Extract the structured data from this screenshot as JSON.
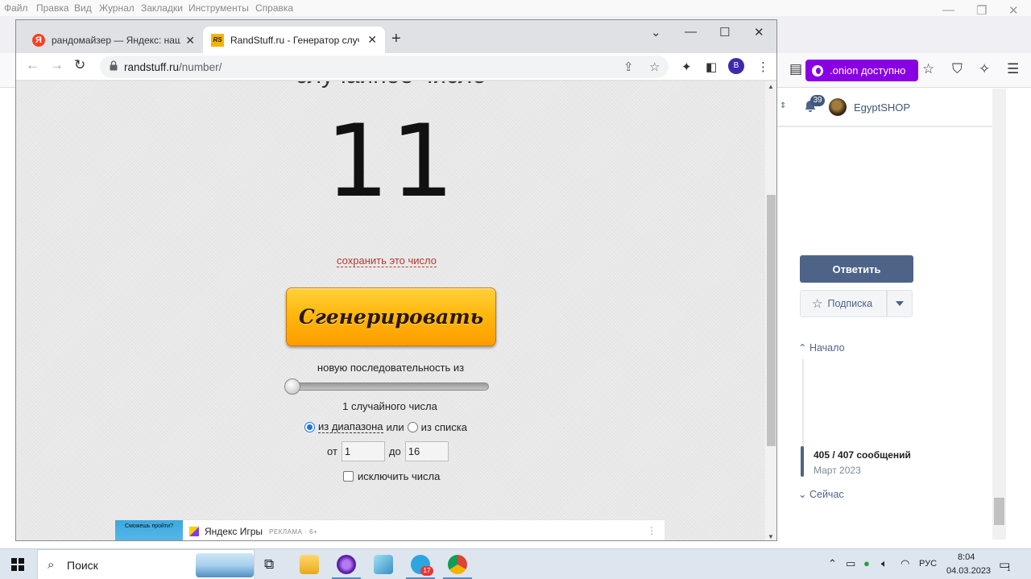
{
  "tor_browser": {
    "menu": [
      "Файл",
      "Правка",
      "Вид",
      "Журнал",
      "Закладки",
      "Инструменты",
      "Справка"
    ],
    "onion_button": ".onion доступно",
    "forum": {
      "notification_count": "39",
      "username": "EgyptSHOP",
      "reply_button": "Ответить",
      "subscribe_button": "Подписка",
      "nav_start": "Начало",
      "messages_count": "405 / 407 сообщений",
      "messages_date": "Март 2023",
      "nav_now": "Сейчас"
    }
  },
  "chrome": {
    "tabs": [
      {
        "title": "рандомайзер — Яндекс: нашло",
        "favicon": "Я",
        "active": false
      },
      {
        "title": "RandStuff.ru - Генератор случай",
        "favicon": "RS",
        "active": true
      }
    ],
    "url_host": "randstuff.ru",
    "url_path": "/number/",
    "profile_initial": "B"
  },
  "page": {
    "heading_partial": "случайное число",
    "result": "11",
    "save_link": "сохранить это число",
    "generate_button": "Сгенерировать",
    "sequence_label": "новую последовательность из",
    "slider_value": 1,
    "count_label": "1 случайного числа",
    "mode_range": "из диапазона",
    "mode_or": "или",
    "mode_list": "из списка",
    "mode_selected": "range",
    "from_label": "от",
    "from_value": "1",
    "to_label": "до",
    "to_value": "16",
    "exclude_label": "исключить числа",
    "exclude_checked": false,
    "ad": {
      "thumb_text": "Сможешь пройти?",
      "title": "Яндекс Игры",
      "tag": "РЕКЛАМА · 6+"
    }
  },
  "taskbar": {
    "search_placeholder": "Поиск",
    "telegram_badge": "17",
    "language": "РУС",
    "time": "8:04",
    "date": "04.03.2023",
    "notification_count": "1"
  }
}
